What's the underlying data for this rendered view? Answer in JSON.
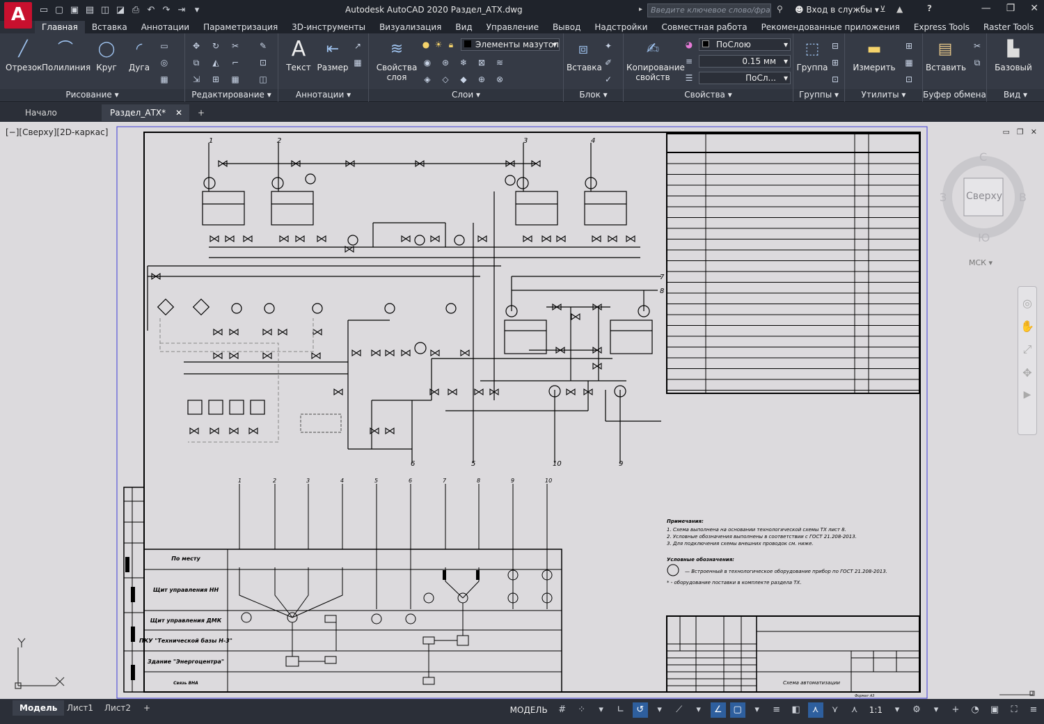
{
  "app": {
    "logo": "A",
    "title": "Autodesk AutoCAD 2020   Раздел_АТХ.dwg",
    "search_placeholder": "Введите ключевое слово/фразу",
    "signin": "Вход в службы",
    "help": "?"
  },
  "ribbon_tabs": [
    "Главная",
    "Вставка",
    "Аннотации",
    "Параметризация",
    "3D-инструменты",
    "Визуализация",
    "Вид",
    "Управление",
    "Вывод",
    "Надстройки",
    "Совместная работа",
    "Рекомендованные приложения",
    "Express Tools",
    "Raster Tools"
  ],
  "draw": {
    "line": "Отрезок",
    "polyline": "Полилиния",
    "circle": "Круг",
    "arc": "Дуга",
    "title": "Рисование"
  },
  "modify": {
    "title": "Редактирование"
  },
  "annot": {
    "text": "Текст",
    "dim": "Размер",
    "title": "Аннотации"
  },
  "layers": {
    "props": "Свойства\nслоя",
    "current": "Элементы мазутоп",
    "title": "Слои"
  },
  "block": {
    "insert": "Вставка",
    "title": "Блок"
  },
  "props": {
    "copy": "Копирование\nсвойств",
    "color": "ПоСлою",
    "lw": "0.15 мм",
    "lt": "ПоСл...",
    "title": "Свойства"
  },
  "groups": {
    "group": "Группа",
    "title": "Группы"
  },
  "utils": {
    "measure": "Измерить",
    "title": "Утилиты"
  },
  "clip": {
    "paste": "Вставить",
    "title": "Буфер обмена"
  },
  "view": {
    "base": "Базовый",
    "title": "Вид"
  },
  "doc_tabs": {
    "start": "Начало",
    "file": "Раздел_АТХ*"
  },
  "viewport": {
    "label": "[−][Сверху][2D-каркас]",
    "cube_top": "Сверху",
    "n": "С",
    "s": "Ю",
    "w": "З",
    "e": "В",
    "ucs": "МСК"
  },
  "layout_tabs": [
    "Модель",
    "Лист1",
    "Лист2"
  ],
  "status": {
    "model": "МОДЕЛЬ",
    "scale": "1:1"
  },
  "drawing": {
    "top_nums": [
      "1",
      "2",
      "3",
      "4"
    ],
    "right_nums": [
      "7",
      "8"
    ],
    "bottom_nums": [
      "6",
      "5",
      "10",
      "9"
    ],
    "lower_nums": [
      "1",
      "2",
      "3",
      "4",
      "5",
      "6",
      "7",
      "8",
      "9",
      "10"
    ],
    "rows": [
      "По месту",
      "Щит управления НН",
      "Щит управления ДМК",
      "ПКУ \"Технической базы Н-3\"",
      "Здание \"Энергоцентра\"",
      "Связь ВНА"
    ],
    "notes_title": "Примечания:",
    "notes": [
      "1. Схема выполнена на основании технологической схемы ТХ лист 8.",
      "2. Условные обозначения выполнены в соответствии с ГОСТ 21.208-2013.",
      "3. Для подключения схемы внешних проводок см. ниже."
    ],
    "legend_title": "Условные обозначения:",
    "legend": [
      "— Встроенный в технологическое оборудование прибор по ГОСТ 21.208-2013.",
      "* - оборудование поставки в комплекте раздела ТХ."
    ],
    "sheet_title": "Схема автоматизации",
    "format": "Формат А3"
  }
}
